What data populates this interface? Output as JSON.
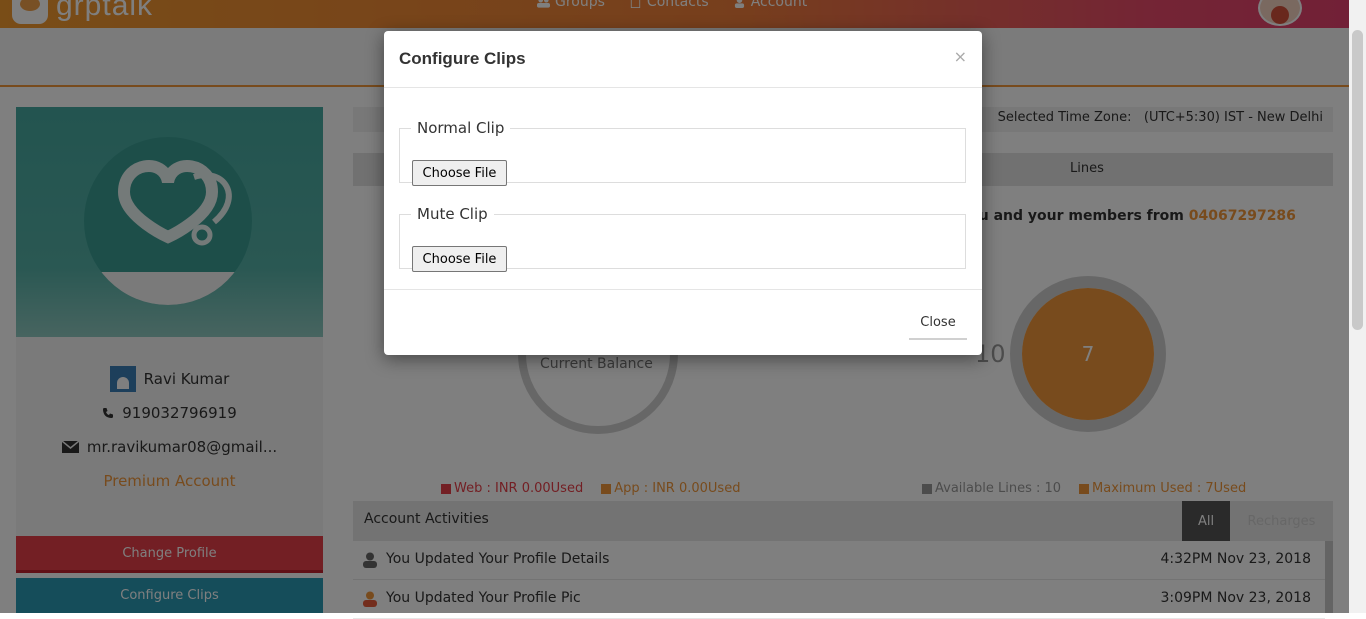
{
  "brand": {
    "logo_text": "grptalk"
  },
  "nav": {
    "items": [
      {
        "label": "Groups",
        "icon": "groups-icon"
      },
      {
        "label": "Contacts",
        "icon": "contacts-icon"
      },
      {
        "label": "Account",
        "icon": "account-icon"
      }
    ]
  },
  "profile": {
    "name": "Ravi Kumar",
    "phone": "919032796919",
    "email": "mr.ravikumar08@gmail...",
    "plan": "Premium Account",
    "change_profile_label": "Change Profile",
    "configure_clips_label": "Configure Clips"
  },
  "timezone": {
    "label": "Selected Time Zone:",
    "value": "(UTC+5:30) IST - New Delhi"
  },
  "lines": {
    "title": "Lines",
    "message_prefix": "you and your members from",
    "number": "04067297286",
    "left_value": "10",
    "used_value": "7"
  },
  "balance": {
    "label": "Current Balance"
  },
  "legends": {
    "web": "Web : INR 0.00Used",
    "app": "App : INR 0.00Used",
    "available": "Available Lines : 10",
    "maximum": "Maximum Used : 7Used"
  },
  "colors": {
    "orange": "#f0973a",
    "red": "#e73f48",
    "teal": "#2b9ab5",
    "grey": "#999999"
  },
  "activities": {
    "title": "Account Activities",
    "tabs": {
      "all": "All",
      "recharges": "Recharges"
    },
    "rows": [
      {
        "text": "You Updated Your Profile Details",
        "time": "4:32PM Nov 23, 2018"
      },
      {
        "text": "You Updated Your Profile Pic",
        "time": "3:09PM Nov 23, 2018"
      }
    ]
  },
  "modal": {
    "title": "Configure Clips",
    "close_x": "×",
    "normal_clip": {
      "legend": "Normal Clip",
      "button": "Choose File"
    },
    "mute_clip": {
      "legend": "Mute Clip",
      "button": "Choose File"
    },
    "close_label": "Close"
  }
}
